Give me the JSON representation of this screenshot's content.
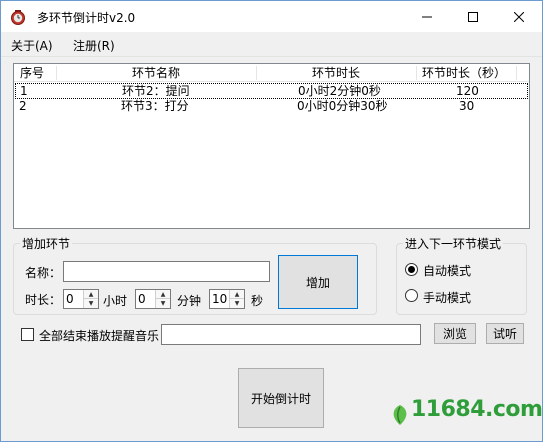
{
  "window": {
    "title": "多环节倒计时v2.0",
    "minimize_icon": "minimize-icon",
    "maximize_icon": "maximize-icon",
    "close_icon": "close-icon",
    "app_icon": "app-clock-icon"
  },
  "menu": {
    "items": [
      {
        "label": "关于(A)"
      },
      {
        "label": "注册(R)"
      }
    ]
  },
  "table": {
    "columns": [
      "序号",
      "环节名称",
      "环节时长",
      "环节时长（秒）"
    ],
    "rows": [
      {
        "index": "1",
        "name": "环节2：提问",
        "duration": "0小时2分钟0秒",
        "seconds": "120"
      },
      {
        "index": "2",
        "name": "环节3：打分",
        "duration": "0小时0分钟30秒",
        "seconds": "30"
      }
    ]
  },
  "add_group": {
    "title": "增加环节",
    "name_label": "名称：",
    "name_value": "",
    "duration_label": "时长：",
    "hours_value": "0",
    "hours_unit": "小时",
    "minutes_value": "0",
    "minutes_unit": "分钟",
    "seconds_value": "10",
    "seconds_unit": "秒",
    "add_button": "增加"
  },
  "mode_group": {
    "title": "进入下一环节模式",
    "auto_label": "自动模式",
    "manual_label": "手动模式",
    "selected": "auto"
  },
  "music": {
    "checkbox_label": "全部结束播放提醒音乐",
    "checked": false,
    "path_value": "",
    "browse_button": "浏览",
    "test_button": "试听"
  },
  "start_button": "开始倒计时",
  "watermark": {
    "text": "11684.com"
  }
}
